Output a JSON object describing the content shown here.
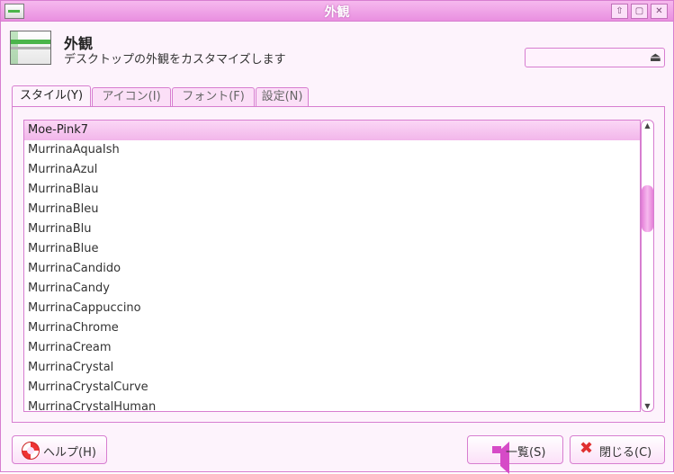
{
  "window": {
    "title": "外観",
    "buttons": [
      "⇧",
      "▢",
      "✕"
    ]
  },
  "header": {
    "title": "外観",
    "description": "デスクトップの外観をカスタマイズします",
    "search": {
      "value": "",
      "placeholder": ""
    }
  },
  "tabs": [
    {
      "label": "スタイル(Y)",
      "active": true
    },
    {
      "label": "アイコン(I)",
      "active": false
    },
    {
      "label": "フォント(F)",
      "active": false
    },
    {
      "label": "設定(N)",
      "active": false
    }
  ],
  "style_list": {
    "selected": "Moe-Pink7",
    "items": [
      "Moe-Pink7",
      "MurrinaAquaIsh",
      "MurrinaAzul",
      "MurrinaBlau",
      "MurrinaBleu",
      "MurrinaBlu",
      "MurrinaBlue",
      "MurrinaCandido",
      "MurrinaCandy",
      "MurrinaCappuccino",
      "MurrinaChrome",
      "MurrinaCream",
      "MurrinaCrystal",
      "MurrinaCrystalCurve",
      "MurrinaCrystalHuman"
    ]
  },
  "footer": {
    "help_label": "ヘルプ(H)",
    "overview_label": "一覧(S)",
    "close_label": "閉じる(C)"
  },
  "colors": {
    "accent": "#e98fe0",
    "border": "#d77ed0",
    "selection": "#f2b6ea"
  }
}
